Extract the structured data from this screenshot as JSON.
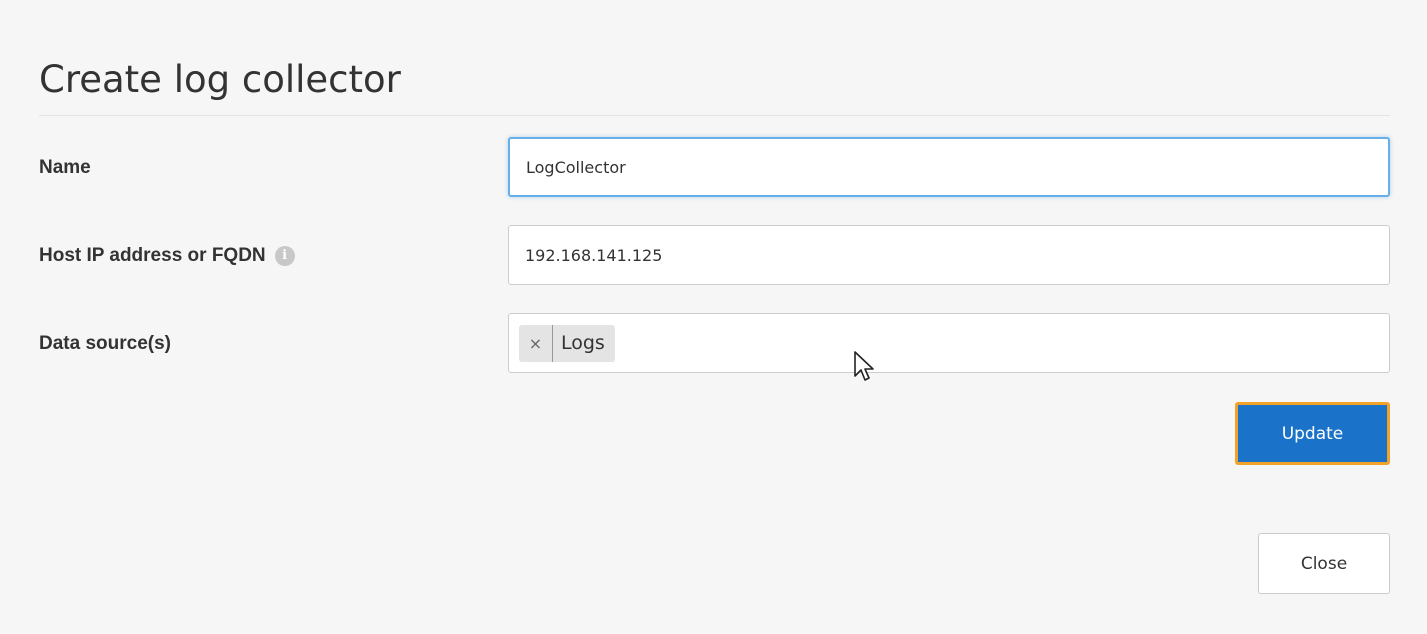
{
  "dialog": {
    "title": "Create log collector"
  },
  "form": {
    "name": {
      "label": "Name",
      "value": "LogCollector"
    },
    "host": {
      "label": "Host IP address or FQDN",
      "info_icon": "info-icon",
      "value": "192.168.141.125"
    },
    "data_sources": {
      "label": "Data source(s)",
      "tags": [
        {
          "remove": "×",
          "label": "Logs"
        }
      ]
    }
  },
  "buttons": {
    "update": "Update",
    "close": "Close"
  },
  "colors": {
    "primary": "#1a73c9",
    "focus_ring": "#f0a22a",
    "input_focus": "#66afe9",
    "background": "#f6f6f6"
  },
  "icons": {
    "info": "i",
    "cursor": "mouse-pointer-icon"
  }
}
